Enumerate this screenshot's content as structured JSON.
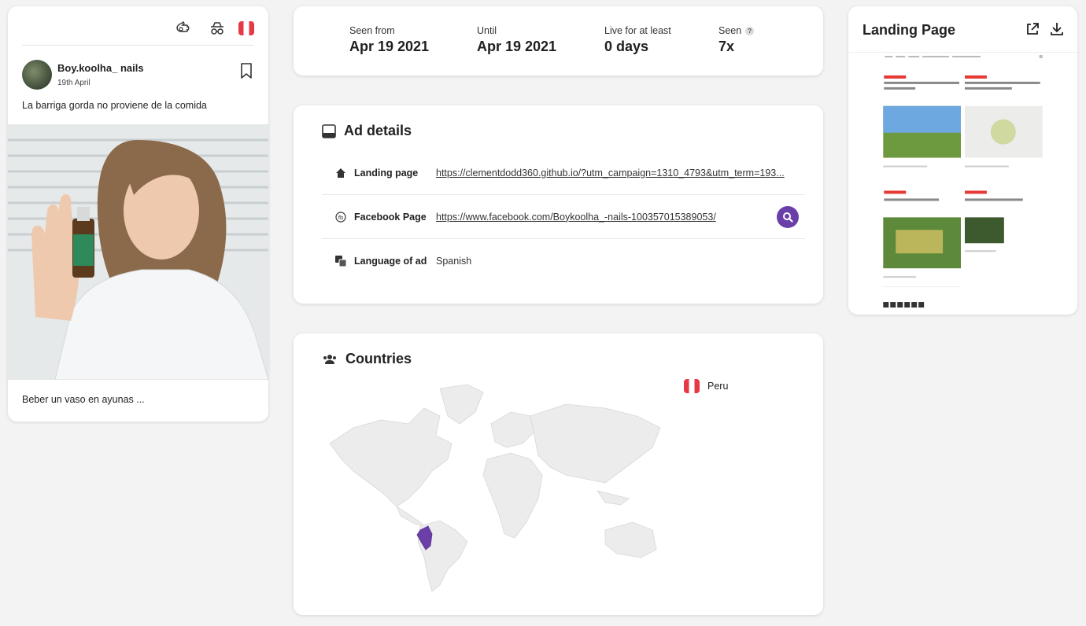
{
  "ad": {
    "page_name": "Boy.koolha_ nails",
    "date": "19th April",
    "text": "La barriga gorda no proviene de la comida",
    "caption": "Beber un vaso en ayunas ...",
    "top_icons": [
      "hand-pointer-icon",
      "incognito-icon",
      "peru-flag-icon"
    ]
  },
  "stats": {
    "seen_from_label": "Seen from",
    "seen_from_value": "Apr 19 2021",
    "until_label": "Until",
    "until_value": "Apr 19 2021",
    "live_label": "Live for at least",
    "live_value": "0 days",
    "seen_label": "Seen",
    "seen_value": "7x",
    "help_glyph": "?"
  },
  "details": {
    "title": "Ad details",
    "rows": [
      {
        "label": "Landing page",
        "value": "https://clementdodd360.github.io/?utm_campaign=1310_4793&utm_term=193...",
        "icon": "home-icon"
      },
      {
        "label": "Facebook Page",
        "value": "https://www.facebook.com/Boykoolha_-nails-100357015389053/",
        "icon": "facebook-icon"
      },
      {
        "label": "Language of ad",
        "value": "Spanish",
        "icon": "translate-icon"
      }
    ]
  },
  "countries": {
    "title": "Countries",
    "items": [
      {
        "name": "Peru",
        "flag": "peru-flag-icon"
      }
    ],
    "highlight_color": "#6b3fa8"
  },
  "landing": {
    "title": "Landing Page",
    "icons": [
      "external-link-icon",
      "download-icon"
    ]
  },
  "colors": {
    "accent": "#6b3fa8",
    "background": "#f3f3f3",
    "flag_red": "#e63946"
  }
}
